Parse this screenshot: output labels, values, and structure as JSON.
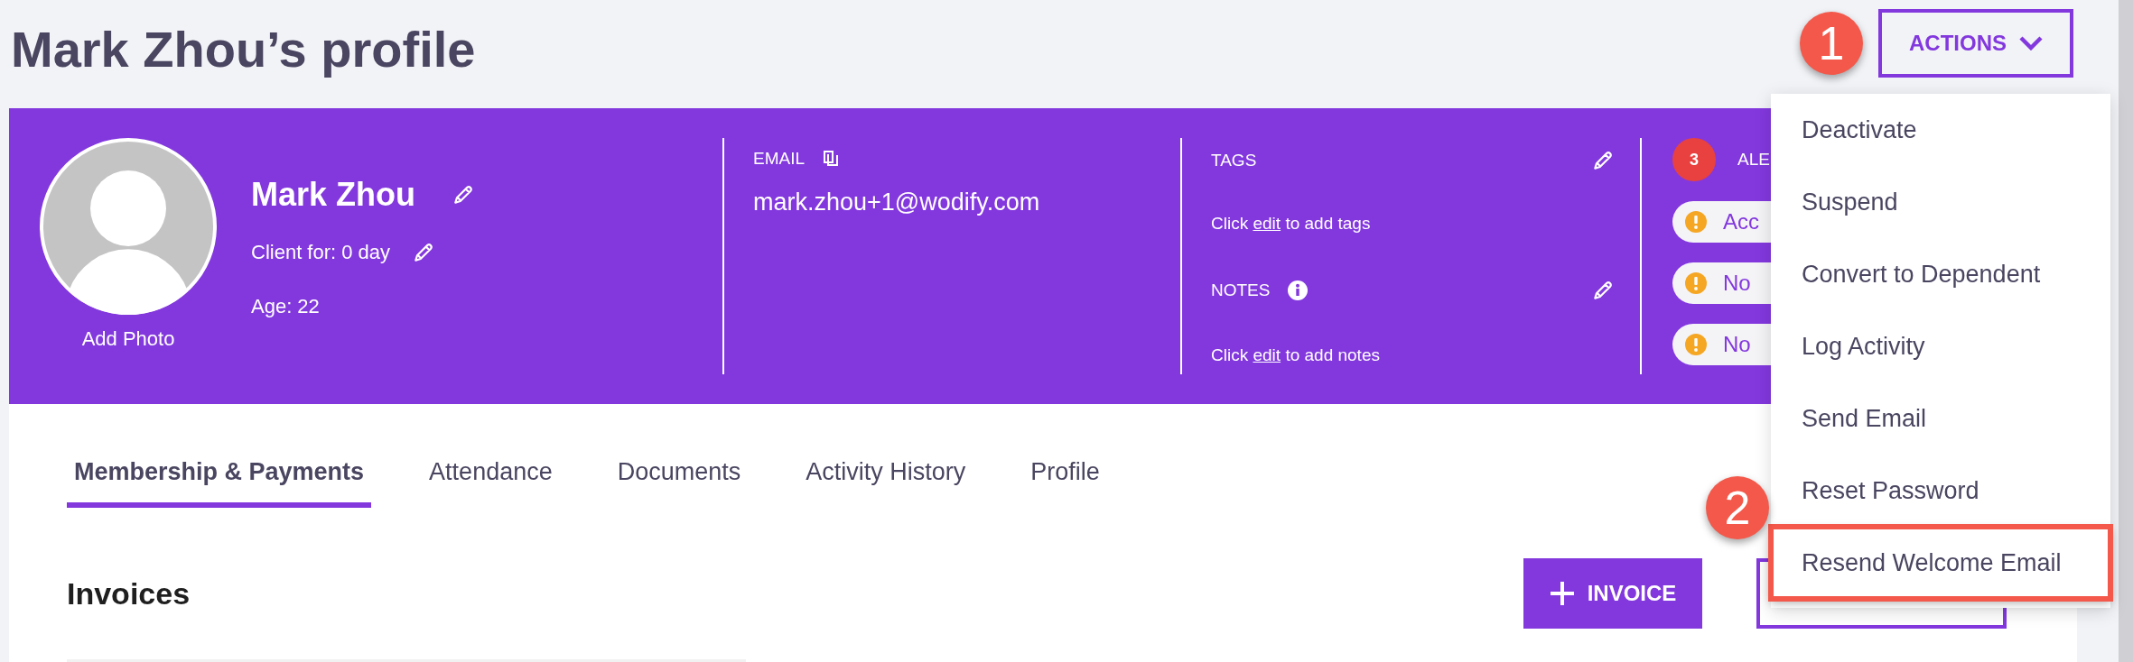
{
  "page": {
    "title": "Mark Zhou’s profile"
  },
  "actions_button": {
    "label": "ACTIONS"
  },
  "callouts": [
    {
      "number": "1"
    },
    {
      "number": "2"
    }
  ],
  "profile": {
    "photo_label": "Add Photo",
    "name": "Mark Zhou",
    "client_for": "Client for: 0 day",
    "age": "Age: 22"
  },
  "email": {
    "label": "EMAIL",
    "value": "mark.zhou+1@wodify.com"
  },
  "tags": {
    "label": "TAGS",
    "hint_before": "Click",
    "link": "edit",
    "hint_after": "to add tags"
  },
  "notes": {
    "label": "NOTES",
    "hint_before": "Click",
    "link": "edit",
    "hint_after": "to add notes"
  },
  "alerts": {
    "count": "3",
    "label": "ALE",
    "items": [
      {
        "text": "Acc"
      },
      {
        "text": "No"
      },
      {
        "text": "No"
      }
    ]
  },
  "tabs": [
    {
      "label": "Membership & Payments",
      "selected": true
    },
    {
      "label": "Attendance",
      "selected": false
    },
    {
      "label": "Documents",
      "selected": false
    },
    {
      "label": "Activity History",
      "selected": false
    },
    {
      "label": "Profile",
      "selected": false
    }
  ],
  "invoices": {
    "title": "Invoices",
    "add_button": "INVOICE"
  },
  "menu": {
    "items": [
      {
        "label": "Deactivate",
        "highlighted": false
      },
      {
        "label": "Suspend",
        "highlighted": false
      },
      {
        "label": "Convert to Dependent",
        "highlighted": false
      },
      {
        "label": "Log Activity",
        "highlighted": false
      },
      {
        "label": "Send Email",
        "highlighted": false
      },
      {
        "label": "Reset Password",
        "highlighted": false
      },
      {
        "label": "Resend Welcome Email",
        "highlighted": true
      }
    ]
  }
}
